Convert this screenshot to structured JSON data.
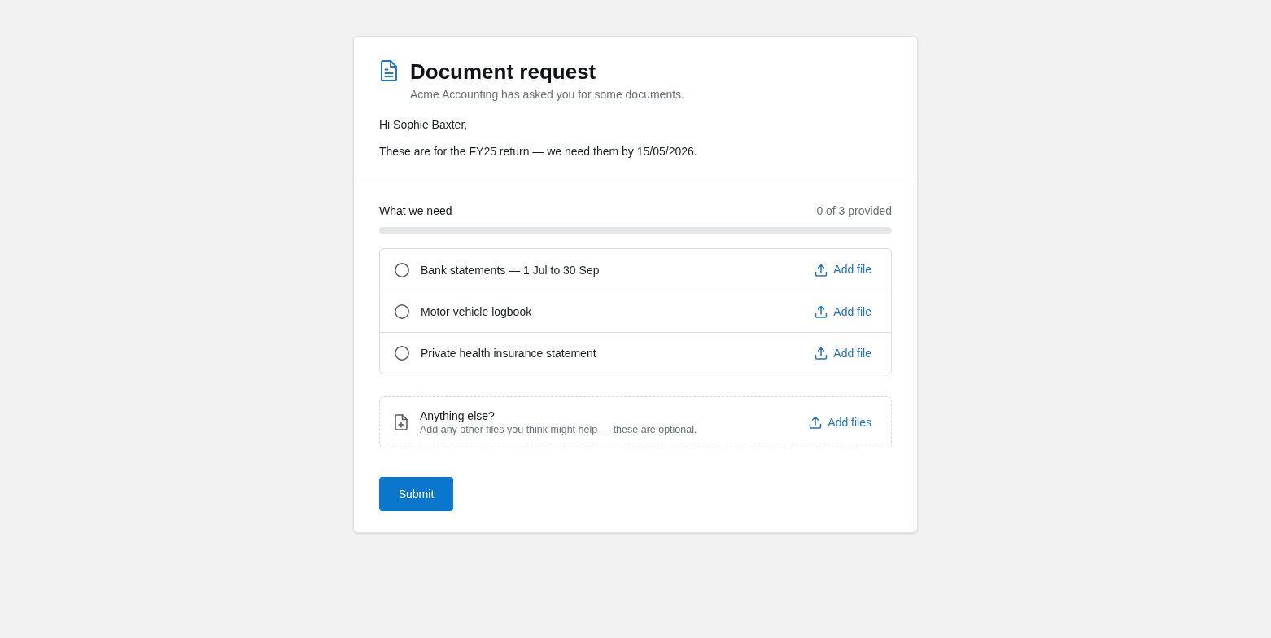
{
  "header": {
    "title": "Document request",
    "subtitle": "Acme Accounting has asked you for some documents."
  },
  "message": {
    "greeting": "Hi Sophie Baxter,",
    "body": "These are for the FY25 return — we need them by 15/05/2026."
  },
  "requirements": {
    "heading": "What we need",
    "count": "0 of 3 provided",
    "progress": {
      "level": 0
    },
    "items": [
      {
        "label": "Bank statements — 1 Jul to 30 Sep",
        "provided": false,
        "action": "Add file"
      },
      {
        "label": "Motor vehicle logbook",
        "provided": false,
        "action": "Add file"
      },
      {
        "label": "Private health insurance statement",
        "provided": false,
        "action": "Add file"
      }
    ]
  },
  "extra": {
    "title": "Anything else?",
    "description": "Add any other files you think might help — these are optional.",
    "action": "Add files"
  },
  "submit": {
    "label": "Submit"
  }
}
